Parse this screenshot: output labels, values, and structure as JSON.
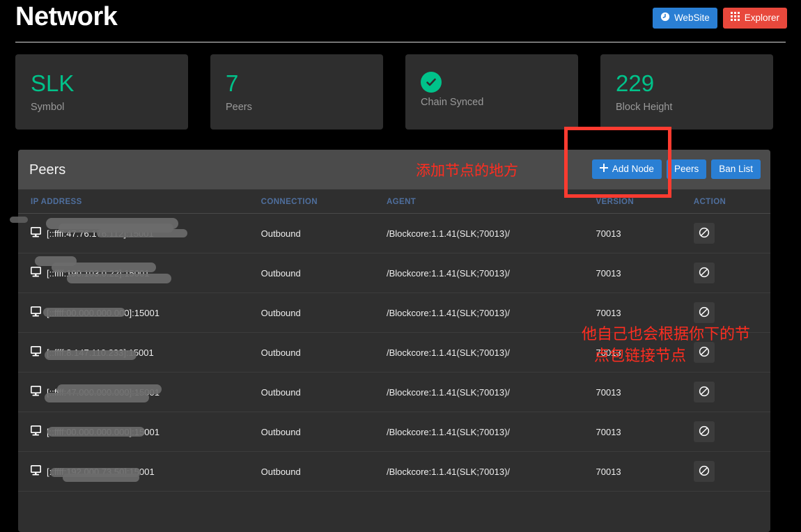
{
  "header": {
    "title": "Network",
    "buttons": [
      {
        "label": "WebSite",
        "icon": "clock-circle-icon",
        "style": "primary"
      },
      {
        "label": "Explorer",
        "icon": "grid-icon",
        "style": "danger"
      }
    ]
  },
  "cards": [
    {
      "value": "SLK",
      "label": "Symbol",
      "type": "value"
    },
    {
      "value": "7",
      "label": "Peers",
      "type": "value"
    },
    {
      "value": "",
      "label": "Chain Synced",
      "type": "check"
    },
    {
      "value": "229",
      "label": "Block Height",
      "type": "value"
    }
  ],
  "panel": {
    "title": "Peers",
    "actions": [
      {
        "label": "Add Node",
        "icon": "plus-icon"
      },
      {
        "label": "Peers",
        "icon": ""
      },
      {
        "label": "Ban List",
        "icon": ""
      }
    ],
    "columns": [
      "IP ADDRESS",
      "CONNECTION",
      "AGENT",
      "VERSION",
      "ACTION"
    ],
    "rows": [
      {
        "ip": "[::ffff:47.76.176.112]:15001",
        "connection": "Outbound",
        "agent": "/Blockcore:1.1.41(SLK;70013)/",
        "version": "70013",
        "action_icon": "ban-icon"
      },
      {
        "ip": "[::ffff:190.103.0.22]:15001",
        "connection": "Outbound",
        "agent": "/Blockcore:1.1.41(SLK;70013)/",
        "version": "70013",
        "action_icon": "ban-icon"
      },
      {
        "ip": "[::ffff:00.000.000.000]:15001",
        "connection": "Outbound",
        "agent": "/Blockcore:1.1.41(SLK;70013)/",
        "version": "70013",
        "action_icon": "ban-icon"
      },
      {
        "ip": "[::ffff:8.147.110.233]:15001",
        "connection": "Outbound",
        "agent": "/Blockcore:1.1.41(SLK;70013)/",
        "version": "70013",
        "action_icon": "ban-icon"
      },
      {
        "ip": "[::ffff:47.000.000.000]:15001",
        "connection": "Outbound",
        "agent": "/Blockcore:1.1.41(SLK;70013)/",
        "version": "70013",
        "action_icon": "ban-icon"
      },
      {
        "ip": "[::ffff:00.000.000.000]:15001",
        "connection": "Outbound",
        "agent": "/Blockcore:1.1.41(SLK;70013)/",
        "version": "70013",
        "action_icon": "ban-icon"
      },
      {
        "ip": "[::ffff:192.000.73.50]:15001",
        "connection": "Outbound",
        "agent": "/Blockcore:1.1.41(SLK;70013)/",
        "version": "70013",
        "action_icon": "ban-icon"
      }
    ]
  },
  "annotations": {
    "add_node_note": "添加节点的地方",
    "auto_connect_note_line1": "他自己也会根据你下的节",
    "auto_connect_note_line2": "点包链接节点"
  },
  "colors": {
    "accent_green": "#00c28a",
    "primary_blue": "#2a7fd4",
    "danger_red": "#e8483c",
    "annotation_red": "#ff2d20",
    "panel_bg": "#2f2f2f",
    "panel_head_bg": "#4b4b4b",
    "card_bg": "#2e2e2e",
    "column_header": "#4f6f9e"
  }
}
